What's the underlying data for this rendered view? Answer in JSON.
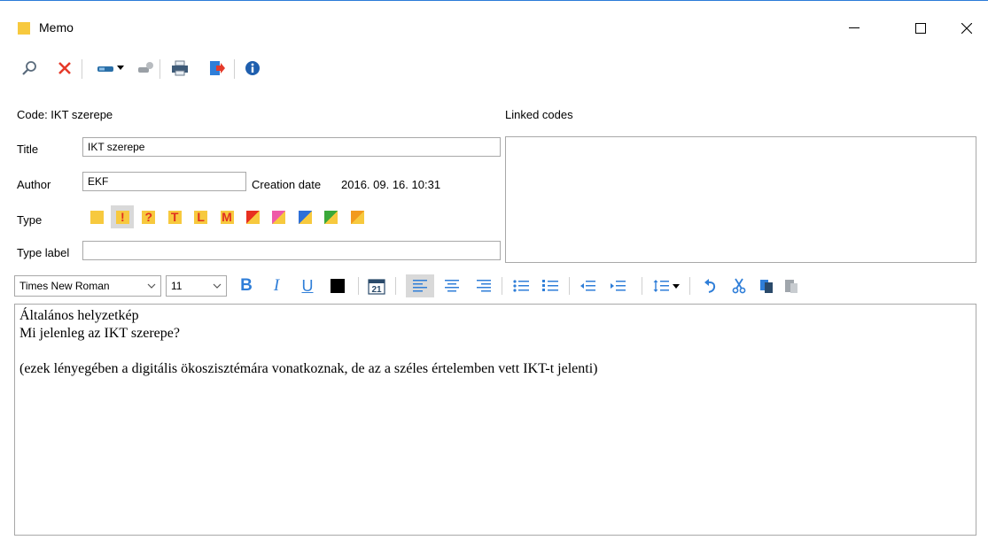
{
  "window": {
    "title": "Memo",
    "icon_color": "#f7c93e"
  },
  "toolbar": {
    "icons": [
      "search-icon",
      "delete-icon",
      "key-dropdown-icon",
      "link-icon",
      "print-icon",
      "export-icon",
      "info-icon"
    ]
  },
  "form": {
    "code_label": "Code: IKT szerepe",
    "linked_codes_label": "Linked codes",
    "title_label": "Title",
    "title_value": "IKT szerepe",
    "author_label": "Author",
    "author_value": "EKF",
    "creation_date_label": "Creation date",
    "creation_date_value": "2016. 09. 16. 10:31",
    "type_label": "Type",
    "type_label_label": "Type label",
    "type_label_value": ""
  },
  "types": [
    {
      "symbol": "",
      "color": "#f7c93e",
      "selected": false
    },
    {
      "symbol": "!",
      "color": "#f7c93e",
      "symbol_color": "#e03020",
      "selected": true
    },
    {
      "symbol": "?",
      "color": "#f7c93e",
      "symbol_color": "#e03020",
      "selected": false
    },
    {
      "symbol": "T",
      "color": "#f7c93e",
      "symbol_color": "#e03020",
      "selected": false
    },
    {
      "symbol": "L",
      "color": "#f7c93e",
      "symbol_color": "#e03020",
      "selected": false
    },
    {
      "symbol": "M",
      "color": "#f7c93e",
      "symbol_color": "#e03020",
      "selected": false
    },
    {
      "symbol": "",
      "color": "#f7c93e",
      "color2": "#e83020",
      "selected": false
    },
    {
      "symbol": "",
      "color": "#f7c93e",
      "color2": "#ee5aa8",
      "selected": false
    },
    {
      "symbol": "",
      "color": "#f7c93e",
      "color2": "#2e6fd8",
      "selected": false
    },
    {
      "symbol": "",
      "color": "#f7c93e",
      "color2": "#3aa83a",
      "selected": false
    },
    {
      "symbol": "",
      "color": "#f7c93e",
      "color2": "#f29a1e",
      "selected": false
    }
  ],
  "format": {
    "font_name": "Times New Roman",
    "font_size": "11",
    "bold_label": "B",
    "italic_label": "I",
    "underline_label": "U",
    "text_color": "#000000",
    "calendar_day": "21"
  },
  "editor": {
    "lines": [
      "Általános helyzetkép",
      "Mi jelenleg az IKT szerepe?",
      "",
      "(ezek lényegében a digitális ökoszisztémára vonatkoznak, de az a széles értelemben vett IKT-t jelenti)"
    ]
  }
}
